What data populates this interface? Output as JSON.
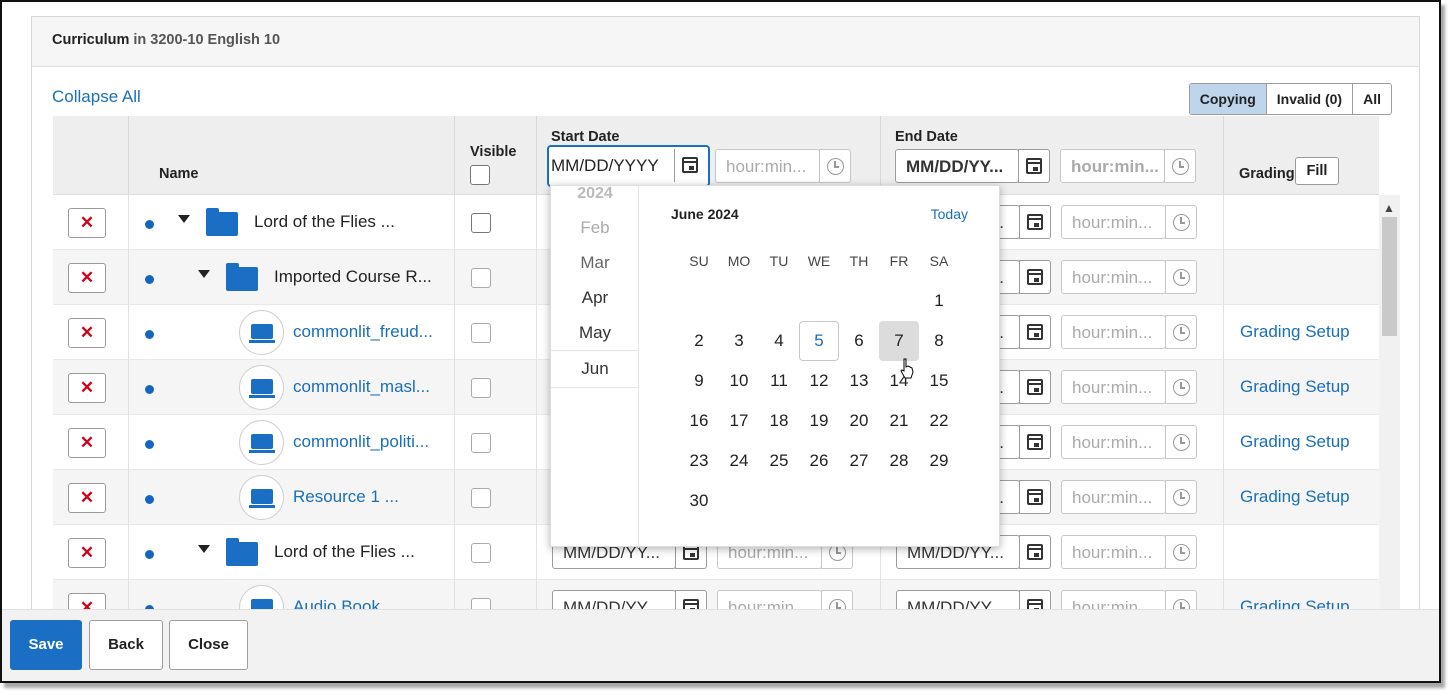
{
  "panel": {
    "title": "Curriculum",
    "context": "in 3200-10 English 10"
  },
  "collapse_all": "Collapse All",
  "filter": {
    "copying": "Copying",
    "invalid": "Invalid (0)",
    "all": "All",
    "selected": "Copying"
  },
  "headers": {
    "name": "Name",
    "visible": "Visible",
    "start_date": "Start Date",
    "end_date": "End Date",
    "grading": "Grading",
    "fill": "Fill"
  },
  "placeholders": {
    "date": "MM/DD/YYYY",
    "date_short": "MM/DD/YY...",
    "time": "hour:min..."
  },
  "rows": [
    {
      "name": "Lord of the Flies ...",
      "type": "folder",
      "level": 0,
      "grading": ""
    },
    {
      "name": "Imported Course R...",
      "type": "folder",
      "level": 1,
      "grading": ""
    },
    {
      "name": "commonlit_freud...",
      "type": "resource",
      "level": 2,
      "grading": "Grading Setup"
    },
    {
      "name": "commonlit_masl...",
      "type": "resource",
      "level": 2,
      "grading": "Grading Setup"
    },
    {
      "name": "commonlit_politi...",
      "type": "resource",
      "level": 2,
      "grading": "Grading Setup"
    },
    {
      "name": "Resource 1 ...",
      "type": "resource",
      "level": 2,
      "grading": "Grading Setup"
    },
    {
      "name": "Lord of the Flies ...",
      "type": "folder",
      "level": 1,
      "grading": ""
    },
    {
      "name": "Audio Book",
      "type": "resource",
      "level": 2,
      "grading": "Grading Setup"
    }
  ],
  "datepicker": {
    "year": "2024",
    "months": [
      "Feb",
      "Mar",
      "Apr",
      "May",
      "Jun"
    ],
    "selected_month": "Jun",
    "title": "June 2024",
    "today_label": "Today",
    "weekdays": [
      "SU",
      "MO",
      "TU",
      "WE",
      "TH",
      "FR",
      "SA"
    ],
    "first_weekday": 6,
    "days_in_month": 30,
    "today_day": 5,
    "hovered_day": 7
  },
  "footer": {
    "save": "Save",
    "back": "Back",
    "close": "Close"
  },
  "colors": {
    "accent": "#1a6fc4",
    "link": "#1a6fb7",
    "delete": "#d0021b",
    "selected_filter": "#bed5ec"
  }
}
